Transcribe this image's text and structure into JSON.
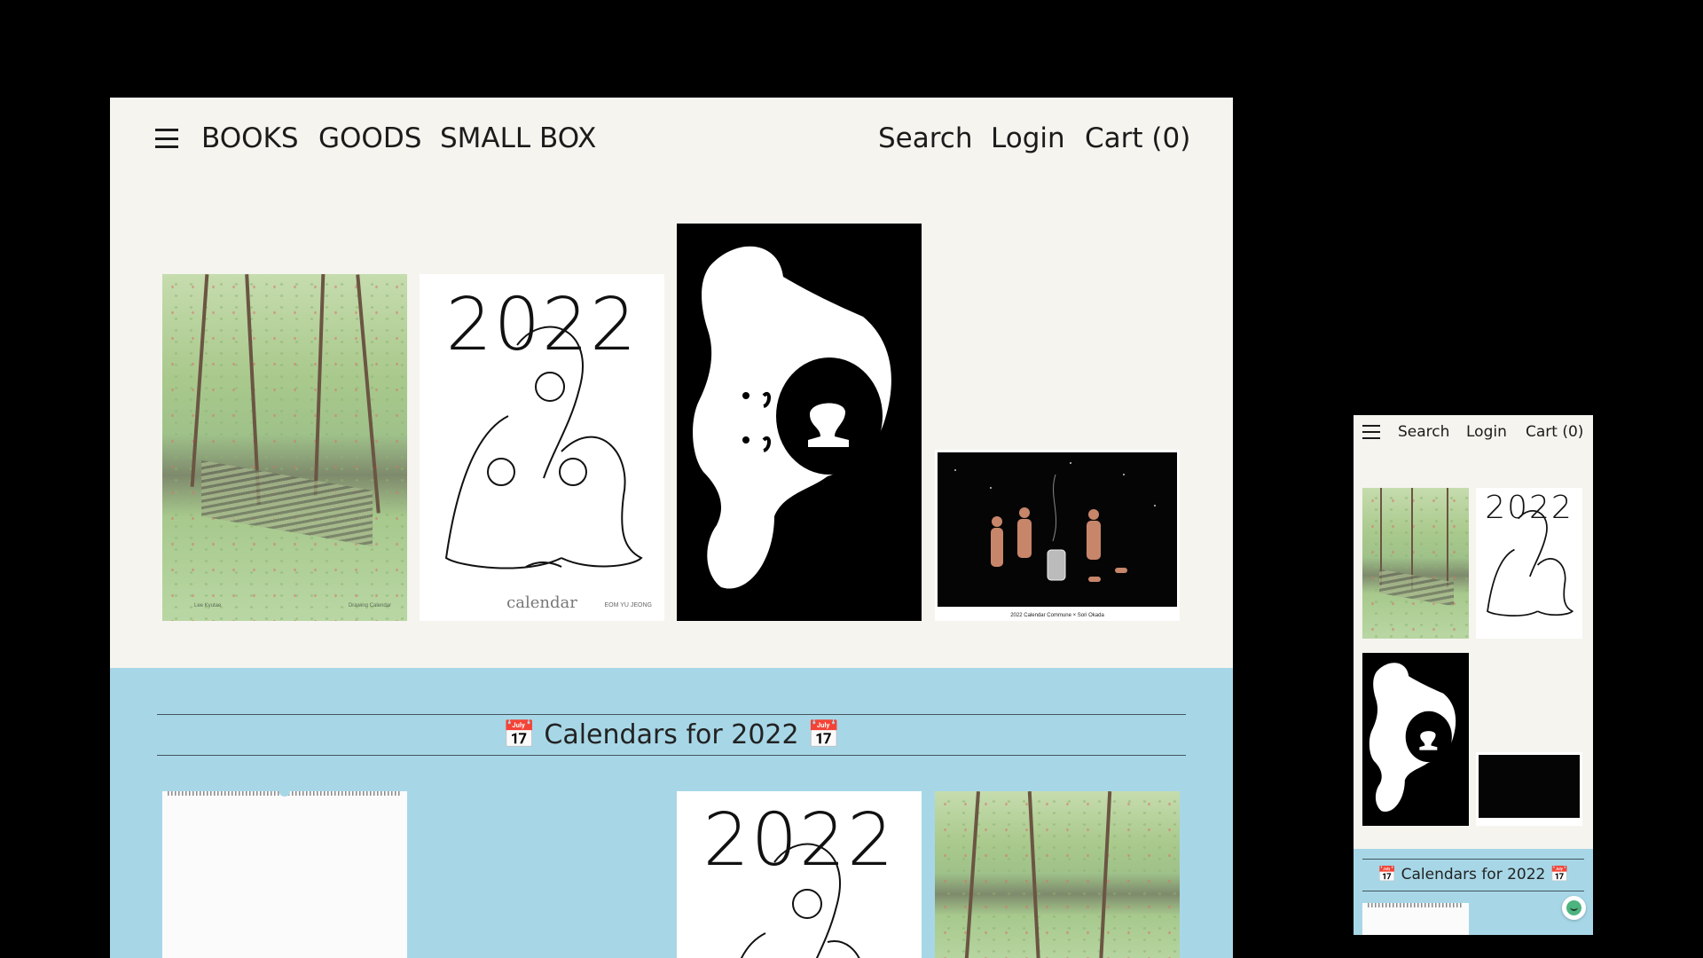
{
  "nav": {
    "menu_icon": "hamburger-menu-icon",
    "links": [
      "BOOKS",
      "GOODS",
      "SMALL BOX"
    ],
    "search": "Search",
    "login": "Login",
    "cart": "Cart (0)"
  },
  "featured": {
    "forest_caption_left": "Lee Kyutae",
    "forest_caption_right": "Drawing Calendar",
    "year": "2022",
    "calendar_word": "calendar",
    "author": "EOM YU JEONG",
    "night_footer": "2022 Calendar   Commune × Sori Okada"
  },
  "section": {
    "heading": "📅 Calendars for 2022 📅"
  },
  "colors": {
    "background": "#f5f4ef",
    "section_blue": "#a7d7e7",
    "text": "#1b1b1b"
  },
  "chat_icon": "chat-widget-icon"
}
